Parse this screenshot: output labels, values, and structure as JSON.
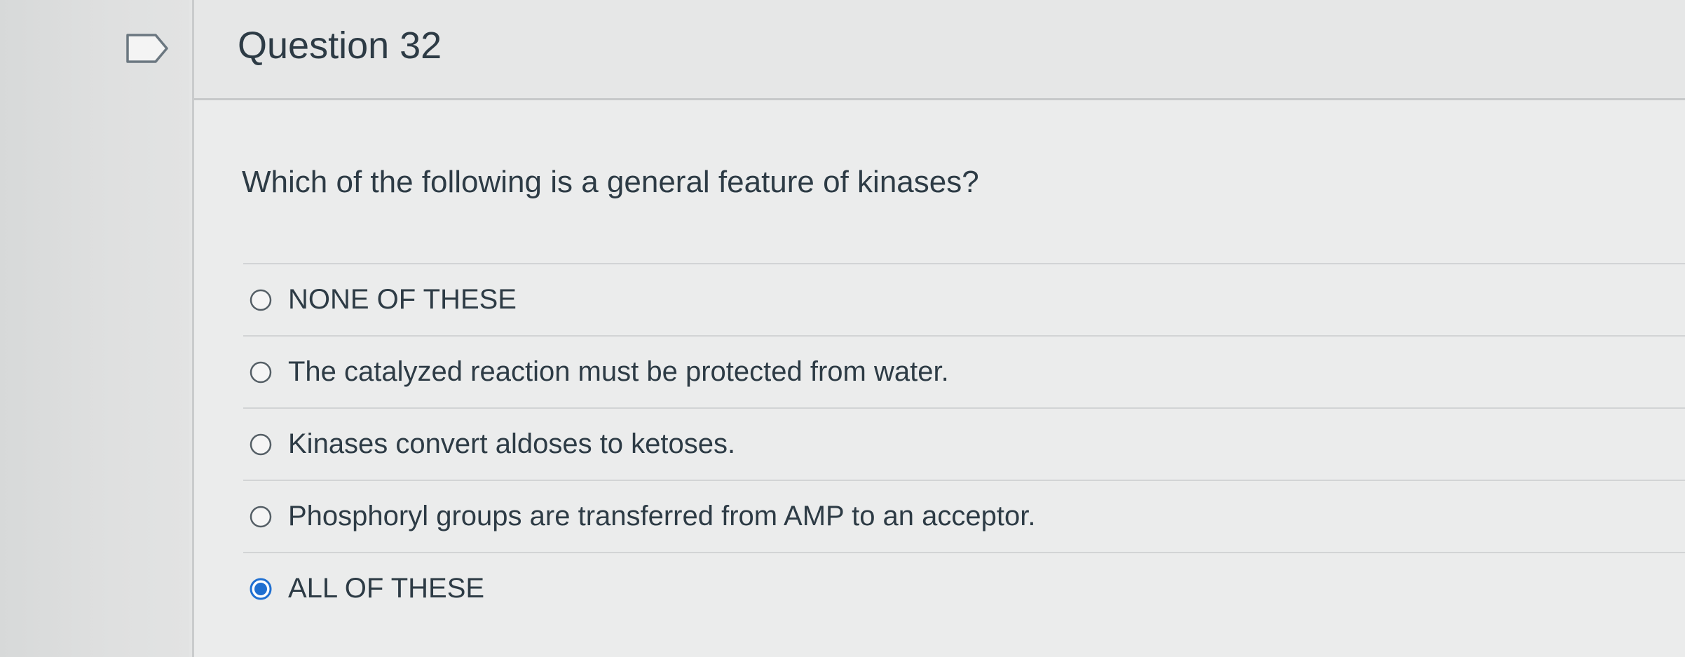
{
  "question": {
    "title": "Question 32",
    "text": "Which of the following is a general feature of kinases?",
    "flag_icon": "flag-bookmark-icon",
    "answers": [
      {
        "label": "NONE OF THESE",
        "selected": false
      },
      {
        "label": "The catalyzed reaction must be protected from water.",
        "selected": false
      },
      {
        "label": "Kinases convert aldoses to ketoses.",
        "selected": false
      },
      {
        "label": "Phosphoryl groups are transferred from AMP to an acceptor.",
        "selected": false
      },
      {
        "label": "ALL OF THESE",
        "selected": true
      }
    ]
  },
  "colors": {
    "text": "#2d3b45",
    "radio_selected": "#1f6fd1",
    "radio_border": "#555f66"
  }
}
